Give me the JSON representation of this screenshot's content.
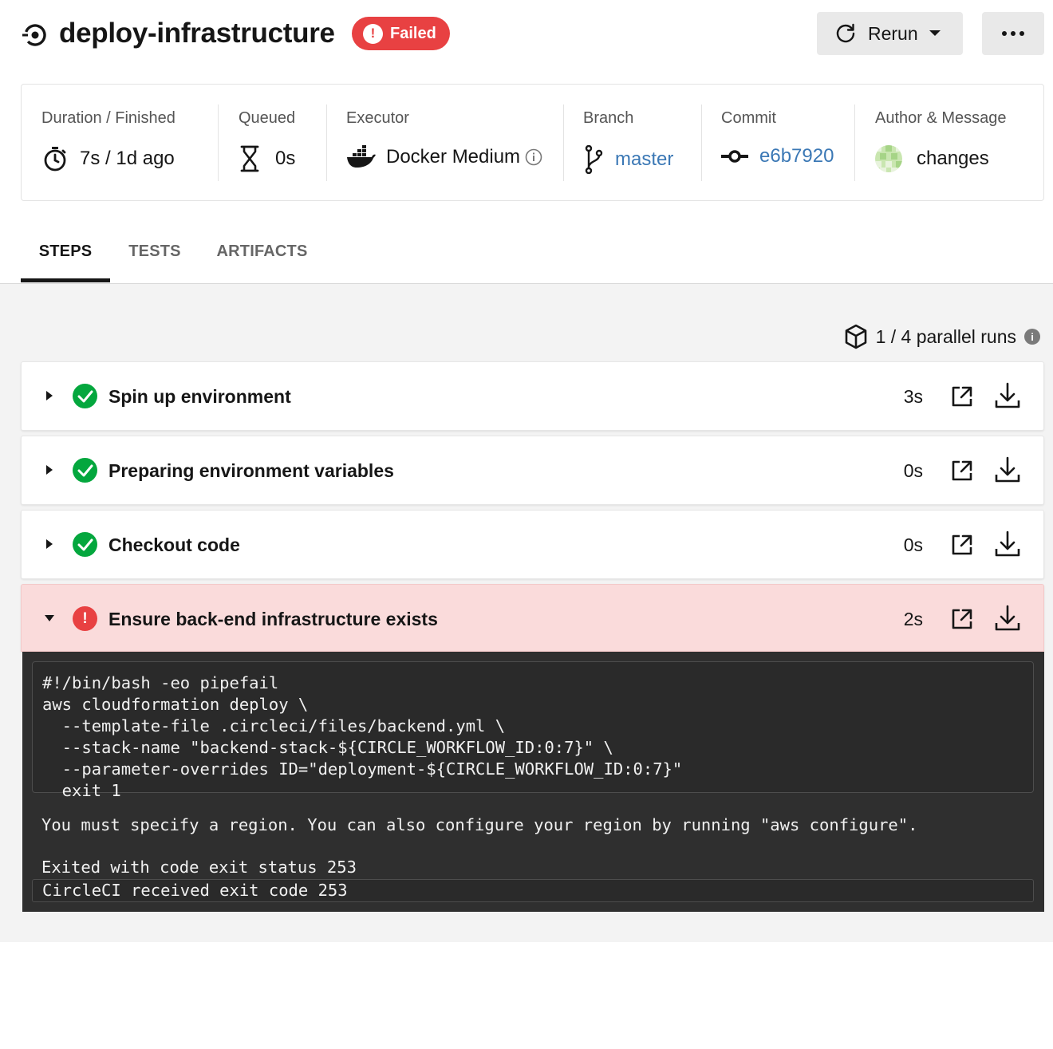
{
  "header": {
    "job_name": "deploy-infrastructure",
    "status": "Failed",
    "rerun_label": "Rerun"
  },
  "info": {
    "duration": {
      "label": "Duration / Finished",
      "value": "7s / 1d ago"
    },
    "queued": {
      "label": "Queued",
      "value": "0s"
    },
    "executor": {
      "label": "Executor",
      "value": "Docker Medium"
    },
    "branch": {
      "label": "Branch",
      "value": "master"
    },
    "commit": {
      "label": "Commit",
      "value": "e6b7920"
    },
    "author": {
      "label": "Author & Message",
      "value": "changes"
    }
  },
  "tabs": [
    {
      "label": "STEPS",
      "active": true
    },
    {
      "label": "TESTS",
      "active": false
    },
    {
      "label": "ARTIFACTS",
      "active": false
    }
  ],
  "parallel_runs": "1 / 4 parallel runs",
  "steps": [
    {
      "name": "Spin up environment",
      "duration": "3s",
      "status": "success"
    },
    {
      "name": "Preparing environment variables",
      "duration": "0s",
      "status": "success"
    },
    {
      "name": "Checkout code",
      "duration": "0s",
      "status": "success"
    },
    {
      "name": "Ensure back-end infrastructure exists",
      "duration": "2s",
      "status": "failed"
    }
  ],
  "terminal": {
    "command_lines": [
      "#!/bin/bash -eo pipefail",
      "aws cloudformation deploy \\",
      "  --template-file .circleci/files/backend.yml \\",
      "  --stack-name \"backend-stack-${CIRCLE_WORKFLOW_ID:0:7}\" \\",
      "  --parameter-overrides ID=\"deployment-${CIRCLE_WORKFLOW_ID:0:7}\"",
      "  exit 1"
    ],
    "error_output": "You must specify a region. You can also configure your region by running \"aws configure\".",
    "exit_message": "Exited with code exit status 253",
    "final_message": "CircleCI received exit code 253"
  },
  "colors": {
    "failed_red": "#e84142",
    "success_green": "#04a73e",
    "link_blue": "#3b78b5",
    "failed_step_bg": "#fadbdb",
    "terminal_bg": "#2f2f2f"
  },
  "icons": {
    "job": "job-circle-icon",
    "duration": "stopwatch-icon",
    "queued": "hourglass-icon",
    "executor": "docker-whale-icon",
    "branch": "git-branch-icon",
    "commit": "git-commit-icon",
    "author": "avatar-identicon",
    "parallel": "cube-icon",
    "open": "external-link-icon",
    "download": "download-icon"
  }
}
